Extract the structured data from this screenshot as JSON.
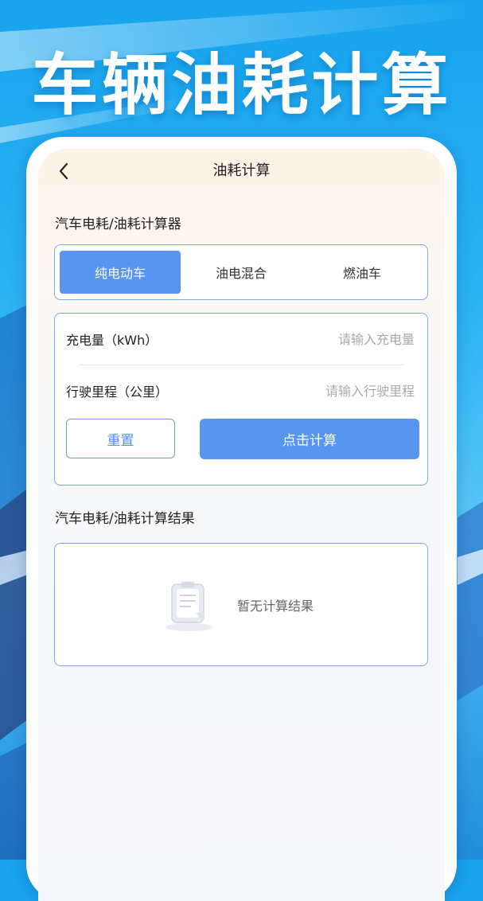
{
  "promo": {
    "title": "车辆油耗计算"
  },
  "nav": {
    "title": "油耗计算",
    "back_icon": "chevron-left-icon"
  },
  "calculator": {
    "section_title": "汽车电耗/油耗计算器",
    "tabs": [
      {
        "label": "纯电动车",
        "active": true
      },
      {
        "label": "油电混合",
        "active": false
      },
      {
        "label": "燃油车",
        "active": false
      }
    ],
    "fields": [
      {
        "label": "充电量（kWh）",
        "value": "",
        "placeholder": "请输入充电量"
      },
      {
        "label": "行驶里程（公里）",
        "value": "",
        "placeholder": "请输入行驶里程"
      }
    ],
    "reset_label": "重置",
    "calc_label": "点击计算"
  },
  "result": {
    "section_title": "汽车电耗/油耗计算结果",
    "empty_text": "暂无计算结果",
    "empty_icon": "empty-clipboard-icon"
  },
  "colors": {
    "accent": "#5895f1",
    "border": "#7ba7e6",
    "background": "#2bb3f3"
  }
}
